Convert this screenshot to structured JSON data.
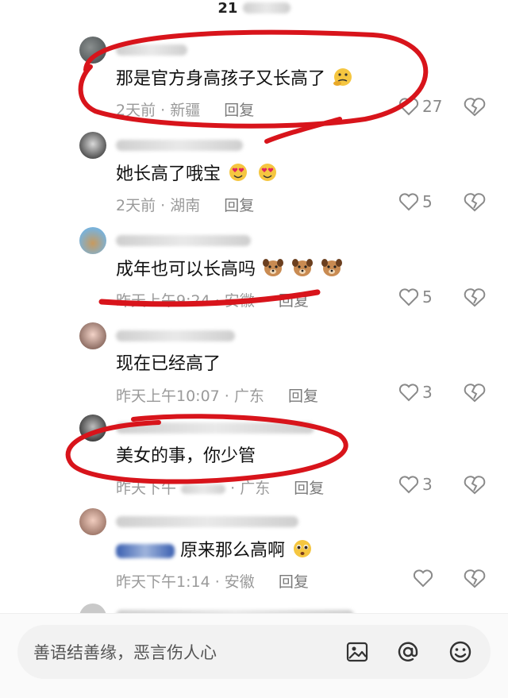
{
  "header": {
    "title_prefix": "21"
  },
  "comments": [
    {
      "content": "那是官方身高孩子又长高了",
      "emoji": "thinking-face",
      "date": "2天前",
      "location": "新疆",
      "reply_label": "回复",
      "likes": "27"
    },
    {
      "content": "她长高了哦宝",
      "emoji": "heart-eyes",
      "date": "2天前",
      "location": "湖南",
      "reply_label": "回复",
      "likes": "5"
    },
    {
      "content": "成年也可以长高吗",
      "emoji": "dog-face",
      "date": "昨天上午9:24",
      "location": "安徽",
      "reply_label": "回复",
      "likes": "5"
    },
    {
      "content": "现在已经高了",
      "date": "昨天上午10:07",
      "location": "广东",
      "reply_label": "回复",
      "likes": "3"
    },
    {
      "content": "美女的事，你少管",
      "date": "昨天下午",
      "location": "广东",
      "reply_label": "回复",
      "likes": "3"
    },
    {
      "content": "原来那么高啊",
      "emoji": "pleading-face",
      "date": "昨天下午1:14",
      "location": "安徽",
      "reply_label": "回复",
      "likes": ""
    }
  ],
  "input": {
    "placeholder": "善语结善缘，恶言伤人心"
  },
  "toolbar_icons": [
    "image-icon",
    "at-icon",
    "emoji-icon"
  ],
  "colors": {
    "annotation_red": "#d8141b",
    "text_primary": "#111111",
    "text_meta": "#9a9a9a"
  }
}
